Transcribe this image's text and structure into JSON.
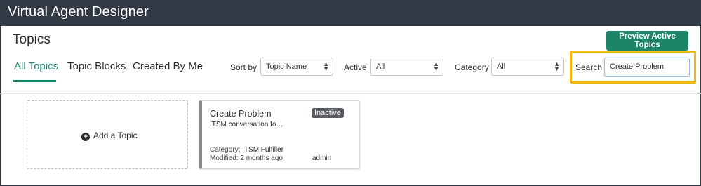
{
  "app": {
    "title": "Virtual Agent Designer"
  },
  "page": {
    "title": "Topics"
  },
  "toolbar": {
    "preview_label": "Preview Active Topics"
  },
  "tabs": [
    {
      "label": "All Topics",
      "active": true
    },
    {
      "label": "Topic Blocks",
      "active": false
    },
    {
      "label": "Created By Me",
      "active": false
    }
  ],
  "filters": {
    "sort_label": "Sort by",
    "sort_value": "Topic Name",
    "active_label": "Active",
    "active_value": "All",
    "category_label": "Category",
    "category_value": "All",
    "search_label": "Search",
    "search_value": "Create Problem"
  },
  "add_card": {
    "label": "Add a Topic",
    "icon": "plus-circle-icon"
  },
  "topics": [
    {
      "name": "Create Problem",
      "status": "Inactive",
      "description": "ITSM conversation fo…",
      "category_label": "Category:",
      "category": "ITSM Fulfiller",
      "modified_label": "Modified:",
      "modified": "2 months ago",
      "owner": "admin"
    }
  ],
  "colors": {
    "titlebar": "#313944",
    "accent": "#1d8468",
    "highlight": "#f2b616",
    "badge": "#5b5f63"
  }
}
